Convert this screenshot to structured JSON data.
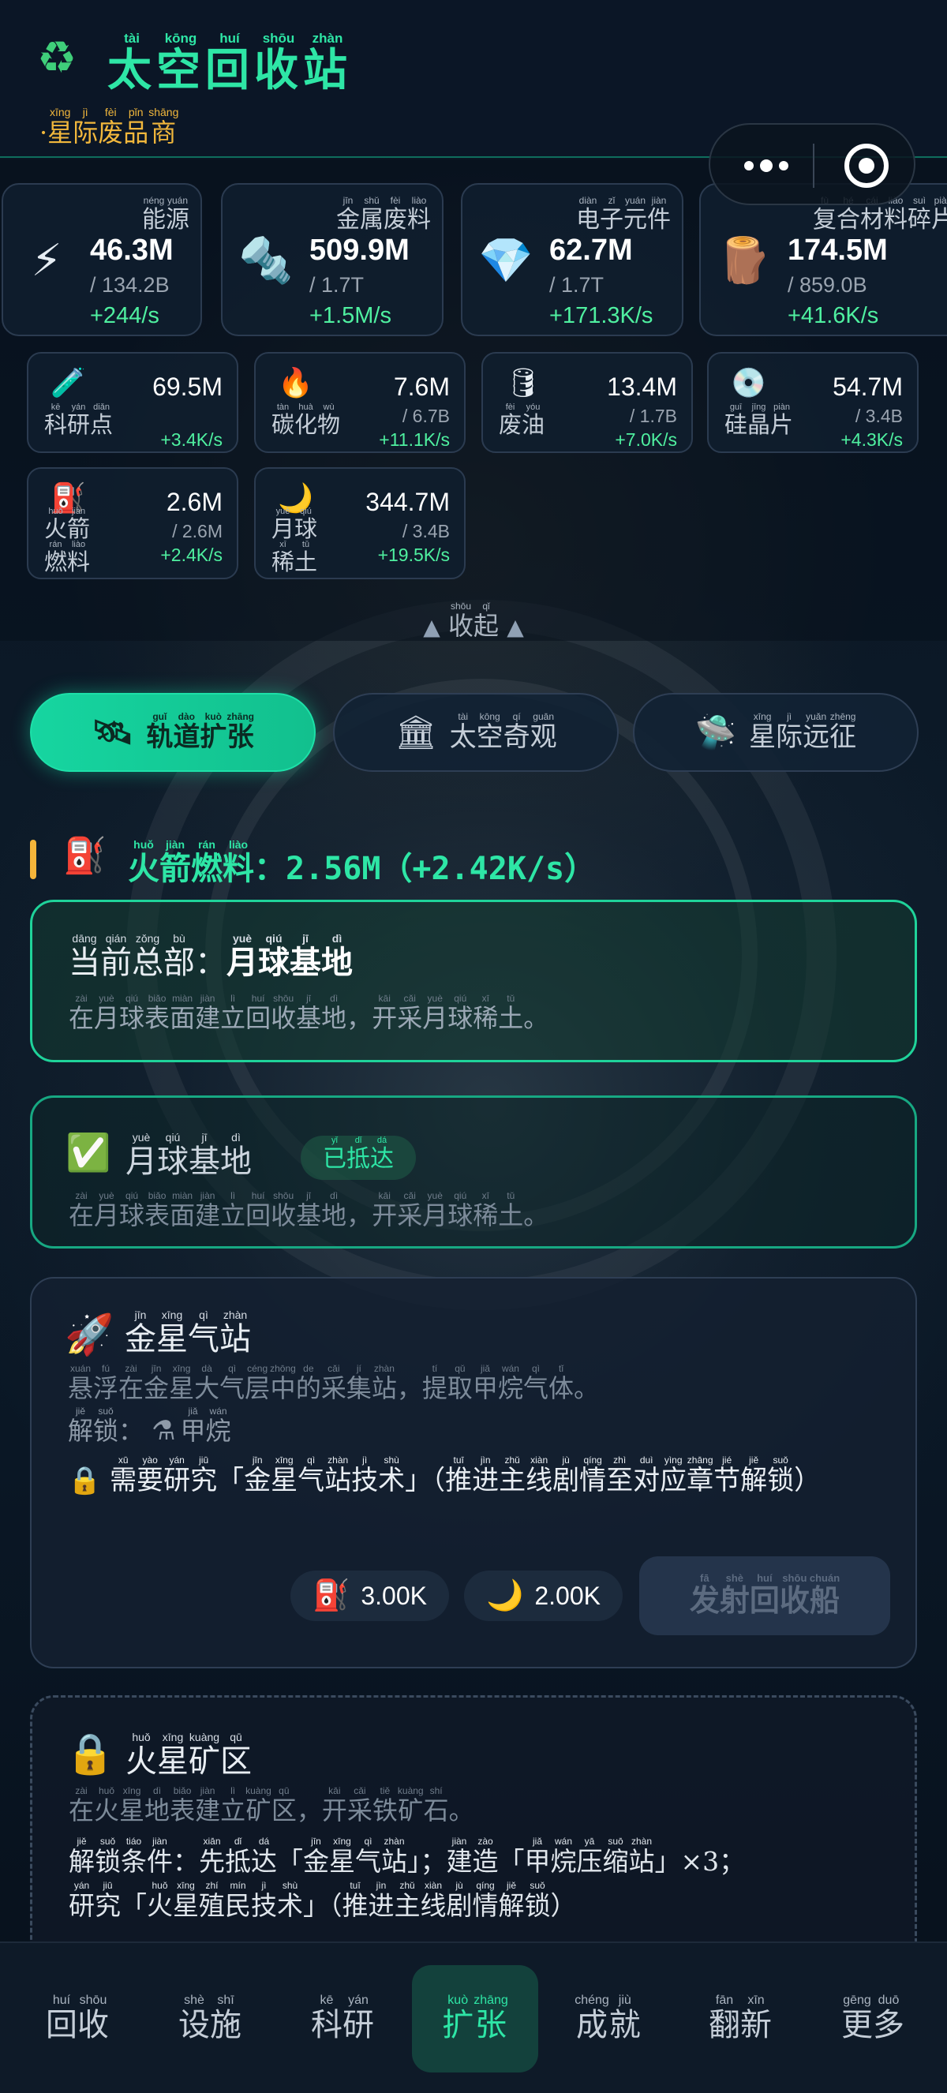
{
  "header": {
    "logo_icon": "recycle-icon",
    "title_chars": [
      [
        "太",
        "tài"
      ],
      [
        "空",
        "kōng"
      ],
      [
        "回",
        "huí"
      ],
      [
        "收",
        "shōu"
      ],
      [
        "站",
        "zhàn"
      ]
    ],
    "subtitle_chars": [
      [
        "星",
        "xīng"
      ],
      [
        "际",
        "jì"
      ],
      [
        "废",
        "fèi"
      ],
      [
        "品",
        "pǐn"
      ],
      [
        "商",
        "shāng"
      ]
    ],
    "subtitle_prefix": "·"
  },
  "resources_big": [
    {
      "icon": "lightning-icon",
      "glyph": "⚡",
      "name": [
        [
          "能",
          "néng"
        ],
        [
          "源",
          "yuán"
        ]
      ],
      "value": "46.3M",
      "cap": "/ 134.2B",
      "rate": "+244/s"
    },
    {
      "icon": "bolt-nut-icon",
      "glyph": "🔩",
      "name": [
        [
          "金",
          "jīn"
        ],
        [
          "属",
          "shǔ"
        ],
        [
          "废",
          "fèi"
        ],
        [
          "料",
          "liào"
        ]
      ],
      "value": "509.9M",
      "cap": "/ 1.7T",
      "rate": "+1.5M/s"
    },
    {
      "icon": "diamond-icon",
      "glyph": "💎",
      "name": [
        [
          "电",
          "diàn"
        ],
        [
          "子",
          "zǐ"
        ],
        [
          "元",
          "yuán"
        ],
        [
          "件",
          "jiàn"
        ]
      ],
      "value": "62.7M",
      "cap": "/ 1.7T",
      "rate": "+171.3K/s"
    },
    {
      "icon": "log-icon",
      "glyph": "🪵",
      "name": [
        [
          "复",
          "fù"
        ],
        [
          "合",
          "hé"
        ],
        [
          "材",
          "cái"
        ],
        [
          "料",
          "liào"
        ],
        [
          "碎",
          "suì"
        ],
        [
          "片",
          "piàn"
        ]
      ],
      "value": "174.5M",
      "cap": "/ 859.0B",
      "rate": "+41.6K/s"
    }
  ],
  "resources_small": [
    {
      "icon": "test-tube-icon",
      "glyph": "🧪",
      "name": [
        [
          "科",
          "kē"
        ],
        [
          "研",
          "yán"
        ],
        [
          "点",
          "diǎn"
        ]
      ],
      "value": "69.5M",
      "cap": "",
      "rate": "+3.4K/s"
    },
    {
      "icon": "fire-icon",
      "glyph": "🔥",
      "name": [
        [
          "碳",
          "tàn"
        ],
        [
          "化",
          "huà"
        ],
        [
          "物",
          "wù"
        ]
      ],
      "value": "7.6M",
      "cap": "/ 6.7B",
      "rate": "+11.1K/s"
    },
    {
      "icon": "oil-barrel-icon",
      "glyph": "🛢",
      "name": [
        [
          "废",
          "fèi"
        ],
        [
          "油",
          "yóu"
        ]
      ],
      "value": "13.4M",
      "cap": "/ 1.7B",
      "rate": "+7.0K/s"
    },
    {
      "icon": "disc-icon",
      "glyph": "💿",
      "name": [
        [
          "硅",
          "guī"
        ],
        [
          "晶",
          "jīng"
        ],
        [
          "片",
          "piàn"
        ]
      ],
      "value": "54.7M",
      "cap": "/ 3.4B",
      "rate": "+4.3K/s"
    },
    {
      "icon": "fuel-pump-icon",
      "glyph": "⛽",
      "name": [
        [
          "火",
          "huǒ"
        ],
        [
          "箭",
          "jiàn"
        ],
        [
          "燃",
          "rán"
        ],
        [
          "料",
          "liào"
        ]
      ],
      "value": "2.6M",
      "cap": "/ 2.6M",
      "rate": "+2.4K/s"
    },
    {
      "icon": "crescent-moon-icon",
      "glyph": "🌙",
      "name": [
        [
          "月",
          "yuè"
        ],
        [
          "球",
          "qiú"
        ],
        [
          "稀",
          "xī"
        ],
        [
          "土",
          "tǔ"
        ]
      ],
      "value": "344.7M",
      "cap": "/ 3.4B",
      "rate": "+19.5K/s"
    }
  ],
  "collapse": {
    "chars": [
      [
        "收",
        "shōu"
      ],
      [
        "起",
        "qǐ"
      ]
    ],
    "icon": "triangle-up-icon"
  },
  "tabs": [
    {
      "icon": "satellite-icon",
      "glyph": "🛰",
      "chars": [
        [
          "轨",
          "guǐ"
        ],
        [
          "道",
          "dào"
        ],
        [
          "扩",
          "kuò"
        ],
        [
          "张",
          "zhāng"
        ]
      ],
      "active": true
    },
    {
      "icon": "classical-building-icon",
      "glyph": "🏛",
      "chars": [
        [
          "太",
          "tài"
        ],
        [
          "空",
          "kōng"
        ],
        [
          "奇",
          "qí"
        ],
        [
          "观",
          "guān"
        ]
      ],
      "active": false
    },
    {
      "icon": "flying-saucer-icon",
      "glyph": "🛸",
      "chars": [
        [
          "星",
          "xīng"
        ],
        [
          "际",
          "jì"
        ],
        [
          "远",
          "yuǎn"
        ],
        [
          "征",
          "zhēng"
        ]
      ],
      "active": false
    }
  ],
  "fuel": {
    "icon": "fuel-pump-icon",
    "label": [
      [
        "火",
        "huǒ"
      ],
      [
        "箭",
        "jiàn"
      ],
      [
        "燃",
        "rán"
      ],
      [
        "料",
        "liào"
      ]
    ],
    "value": "：2.56M（+2.42K/s）"
  },
  "hq": {
    "label": [
      [
        "当",
        "dāng"
      ],
      [
        "前",
        "qián"
      ],
      [
        "总",
        "zǒng"
      ],
      [
        "部",
        "bù"
      ]
    ],
    "colon": "：",
    "name": [
      [
        "月",
        "yuè"
      ],
      [
        "球",
        "qiú"
      ],
      [
        "基",
        "jī"
      ],
      [
        "地",
        "dì"
      ]
    ],
    "desc": [
      [
        "在",
        "zài"
      ],
      [
        "月",
        "yuè"
      ],
      [
        "球",
        "qiú"
      ],
      [
        "表",
        "biǎo"
      ],
      [
        "面",
        "miàn"
      ],
      [
        "建",
        "jiàn"
      ],
      [
        "立",
        "lì"
      ],
      [
        "回",
        "huí"
      ],
      [
        "收",
        "shōu"
      ],
      [
        "基",
        "jī"
      ],
      [
        "地",
        "dì"
      ],
      [
        "，",
        ""
      ],
      [
        "开",
        "kāi"
      ],
      [
        "采",
        "cǎi"
      ],
      [
        "月",
        "yuè"
      ],
      [
        "球",
        "qiú"
      ],
      [
        "稀",
        "xī"
      ],
      [
        "土",
        "tǔ"
      ],
      [
        "。",
        ""
      ]
    ]
  },
  "moon_base": {
    "icon": "check-mark-icon",
    "name": [
      [
        "月",
        "yuè"
      ],
      [
        "球",
        "qiú"
      ],
      [
        "基",
        "jī"
      ],
      [
        "地",
        "dì"
      ]
    ],
    "badge": [
      [
        "已",
        "yǐ"
      ],
      [
        "抵",
        "dǐ"
      ],
      [
        "达",
        "dá"
      ]
    ],
    "desc": [
      [
        "在",
        "zài"
      ],
      [
        "月",
        "yuè"
      ],
      [
        "球",
        "qiú"
      ],
      [
        "表",
        "biǎo"
      ],
      [
        "面",
        "miàn"
      ],
      [
        "建",
        "jiàn"
      ],
      [
        "立",
        "lì"
      ],
      [
        "回",
        "huí"
      ],
      [
        "收",
        "shōu"
      ],
      [
        "基",
        "jī"
      ],
      [
        "地",
        "dì"
      ],
      [
        "，",
        ""
      ],
      [
        "开",
        "kāi"
      ],
      [
        "采",
        "cǎi"
      ],
      [
        "月",
        "yuè"
      ],
      [
        "球",
        "qiú"
      ],
      [
        "稀",
        "xī"
      ],
      [
        "土",
        "tǔ"
      ],
      [
        "。",
        ""
      ]
    ]
  },
  "venus": {
    "icon": "rocket-icon",
    "name": [
      [
        "金",
        "jīn"
      ],
      [
        "星",
        "xīng"
      ],
      [
        "气",
        "qì"
      ],
      [
        "站",
        "zhàn"
      ]
    ],
    "desc": [
      [
        "悬",
        "xuán"
      ],
      [
        "浮",
        "fú"
      ],
      [
        "在",
        "zài"
      ],
      [
        "金",
        "jīn"
      ],
      [
        "星",
        "xīng"
      ],
      [
        "大",
        "dà"
      ],
      [
        "气",
        "qì"
      ],
      [
        "层",
        "céng"
      ],
      [
        "中",
        "zhōng"
      ],
      [
        "的",
        "de"
      ],
      [
        "采",
        "cǎi"
      ],
      [
        "集",
        "jí"
      ],
      [
        "站",
        "zhàn"
      ],
      [
        "，",
        ""
      ],
      [
        "提",
        "tí"
      ],
      [
        "取",
        "qǔ"
      ],
      [
        "甲",
        "jiǎ"
      ],
      [
        "烷",
        "wán"
      ],
      [
        "气",
        "qì"
      ],
      [
        "体",
        "tǐ"
      ],
      [
        "。",
        ""
      ]
    ],
    "unlock_label": [
      [
        "解",
        "jiě"
      ],
      [
        "锁",
        "suǒ"
      ],
      [
        "：",
        ""
      ]
    ],
    "unlock_icon": "flask-icon",
    "unlock_item": [
      [
        "甲",
        "jiǎ"
      ],
      [
        "烷",
        "wán"
      ]
    ],
    "req_icon": "lock-icon",
    "req": [
      [
        "需",
        "xū"
      ],
      [
        "要",
        "yào"
      ],
      [
        "研",
        "yán"
      ],
      [
        "究",
        "jiū"
      ],
      [
        "「",
        ""
      ],
      [
        "金",
        "jīn"
      ],
      [
        "星",
        "xīng"
      ],
      [
        "气",
        "qì"
      ],
      [
        "站",
        "zhàn"
      ],
      [
        "技",
        "jì"
      ],
      [
        "术",
        "shù"
      ],
      [
        "」",
        ""
      ],
      [
        "（",
        ""
      ],
      [
        "推",
        "tuī"
      ],
      [
        "进",
        "jìn"
      ],
      [
        "主",
        "zhǔ"
      ],
      [
        "线",
        "xiàn"
      ],
      [
        "剧",
        "jù"
      ],
      [
        "情",
        "qíng"
      ],
      [
        "至",
        "zhì"
      ],
      [
        "对",
        "duì"
      ],
      [
        "应",
        "yìng"
      ],
      [
        "章",
        "zhāng"
      ],
      [
        "节",
        "jié"
      ],
      [
        "解",
        "jiě"
      ],
      [
        "锁",
        "suǒ"
      ],
      [
        "）",
        ""
      ]
    ],
    "costs": [
      {
        "icon": "fuel-pump-icon",
        "glyph": "⛽",
        "value": "3.00K"
      },
      {
        "icon": "crescent-moon-icon",
        "glyph": "🌙",
        "value": "2.00K"
      }
    ],
    "launch": [
      [
        "发",
        "fā"
      ],
      [
        "射",
        "shè"
      ],
      [
        "回",
        "huí"
      ],
      [
        "收",
        "shōu"
      ],
      [
        "船",
        "chuán"
      ]
    ]
  },
  "mars": {
    "icon": "lock-icon",
    "name": [
      [
        "火",
        "huǒ"
      ],
      [
        "星",
        "xīng"
      ],
      [
        "矿",
        "kuàng"
      ],
      [
        "区",
        "qū"
      ]
    ],
    "desc": [
      [
        "在",
        "zài"
      ],
      [
        "火",
        "huǒ"
      ],
      [
        "星",
        "xīng"
      ],
      [
        "地",
        "dì"
      ],
      [
        "表",
        "biǎo"
      ],
      [
        "建",
        "jiàn"
      ],
      [
        "立",
        "lì"
      ],
      [
        "矿",
        "kuàng"
      ],
      [
        "区",
        "qū"
      ],
      [
        "，",
        ""
      ],
      [
        "开",
        "kāi"
      ],
      [
        "采",
        "cǎi"
      ],
      [
        "铁",
        "tiě"
      ],
      [
        "矿",
        "kuàng"
      ],
      [
        "石",
        "shí"
      ],
      [
        "。",
        ""
      ]
    ],
    "cond1": [
      [
        "解",
        "jiě"
      ],
      [
        "锁",
        "suǒ"
      ],
      [
        "条",
        "tiáo"
      ],
      [
        "件",
        "jiàn"
      ],
      [
        "：",
        ""
      ],
      [
        "先",
        "xiān"
      ],
      [
        "抵",
        "dǐ"
      ],
      [
        "达",
        "dá"
      ],
      [
        "「",
        ""
      ],
      [
        "金",
        "jīn"
      ],
      [
        "星",
        "xīng"
      ],
      [
        "气",
        "qì"
      ],
      [
        "站",
        "zhàn"
      ],
      [
        "」",
        ""
      ],
      [
        "；",
        ""
      ],
      [
        "建",
        "jiàn"
      ],
      [
        "造",
        "zào"
      ],
      [
        "「",
        ""
      ],
      [
        "甲",
        "jiǎ"
      ],
      [
        "烷",
        "wán"
      ],
      [
        "压",
        "yā"
      ],
      [
        "缩",
        "suō"
      ],
      [
        "站",
        "zhàn"
      ],
      [
        "」",
        ""
      ],
      [
        "×3；",
        ""
      ]
    ],
    "cond2": [
      [
        "研",
        "yán"
      ],
      [
        "究",
        "jiū"
      ],
      [
        "「",
        ""
      ],
      [
        "火",
        "huǒ"
      ],
      [
        "星",
        "xīng"
      ],
      [
        "殖",
        "zhí"
      ],
      [
        "民",
        "mín"
      ],
      [
        "技",
        "jì"
      ],
      [
        "术",
        "shù"
      ],
      [
        "」",
        ""
      ],
      [
        "（",
        ""
      ],
      [
        "推",
        "tuī"
      ],
      [
        "进",
        "jìn"
      ],
      [
        "主",
        "zhǔ"
      ],
      [
        "线",
        "xiàn"
      ],
      [
        "剧",
        "jù"
      ],
      [
        "情",
        "qíng"
      ],
      [
        "解",
        "jiě"
      ],
      [
        "锁",
        "suǒ"
      ],
      [
        "）",
        ""
      ]
    ]
  },
  "nav": [
    {
      "chars": [
        [
          "回",
          "huí"
        ],
        [
          "收",
          "shōu"
        ]
      ],
      "active": false
    },
    {
      "chars": [
        [
          "设",
          "shè"
        ],
        [
          "施",
          "shī"
        ]
      ],
      "active": false
    },
    {
      "chars": [
        [
          "科",
          "kē"
        ],
        [
          "研",
          "yán"
        ]
      ],
      "active": false
    },
    {
      "chars": [
        [
          "扩",
          "kuò"
        ],
        [
          "张",
          "zhāng"
        ]
      ],
      "active": true
    },
    {
      "chars": [
        [
          "成",
          "chéng"
        ],
        [
          "就",
          "jiù"
        ]
      ],
      "active": false
    },
    {
      "chars": [
        [
          "翻",
          "fān"
        ],
        [
          "新",
          "xīn"
        ]
      ],
      "active": false
    },
    {
      "chars": [
        [
          "更",
          "gēng"
        ],
        [
          "多",
          "duō"
        ]
      ],
      "active": false
    }
  ],
  "colors": {
    "accent": "#2ee6a6",
    "gold": "#f1b73c",
    "rate": "#4ff0a0",
    "bg": "#08111d"
  }
}
